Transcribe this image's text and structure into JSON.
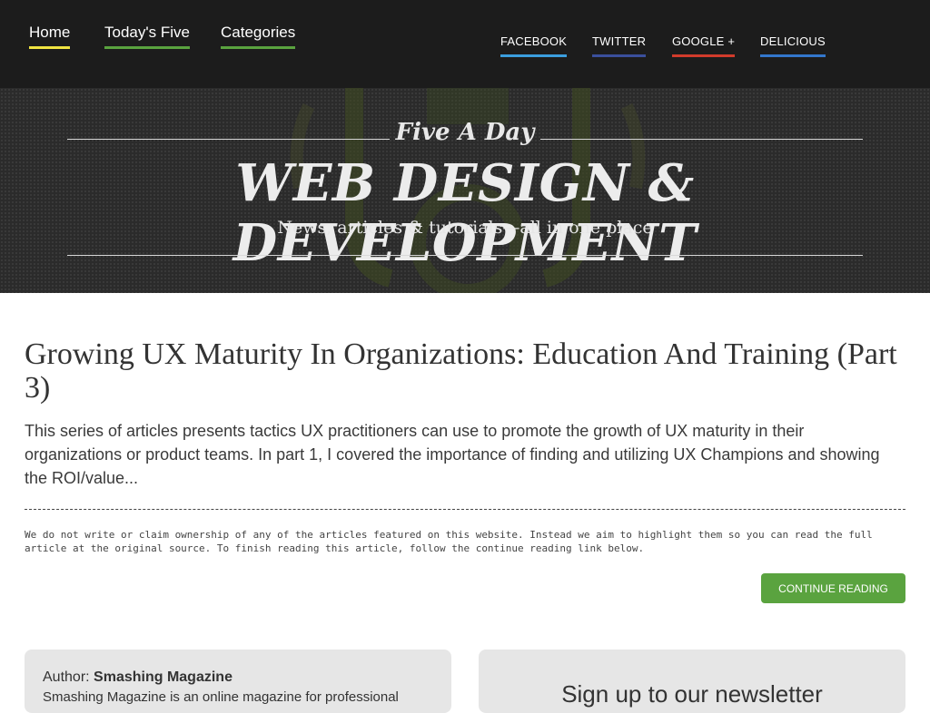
{
  "nav": {
    "main": [
      {
        "label": "Home",
        "color": "#f0e442"
      },
      {
        "label": "Today's Five",
        "color": "#5aa33f"
      },
      {
        "label": "Categories",
        "color": "#5aa33f"
      }
    ],
    "social": [
      {
        "label": "FACEBOOK",
        "color": "#3b9ede"
      },
      {
        "label": "TWITTER",
        "color": "#3a4f9c"
      },
      {
        "label": "GOOGLE +",
        "color": "#d13b2b"
      },
      {
        "label": "DELICIOUS",
        "color": "#3377cc"
      }
    ]
  },
  "hero": {
    "tagline": "Five A Day",
    "title": "WEB DESIGN & DEVELOPMENT",
    "subtitle": "News, articles & tutorials—all in one place"
  },
  "article": {
    "title": "Growing UX Maturity In Organizations: Education And Training (Part 3)",
    "excerpt": "This series of articles presents tactics UX practitioners can use to promote the growth of UX maturity in their organizations or product teams. In part 1, I covered the importance of finding and utilizing UX Champions and showing the ROI/value...",
    "disclaimer": "We do not write or claim ownership of any of the articles featured on this website. Instead we aim to highlight them so you can read the full article at the original source. To finish reading this article, follow the continue reading link below.",
    "continue_label": "CONTINUE READING"
  },
  "author": {
    "label": "Author:",
    "name": "Smashing Magazine",
    "bio": "Smashing Magazine is an online magazine for professional"
  },
  "newsletter": {
    "title": "Sign up to our newsletter"
  },
  "colors": {
    "accent_green": "#5aa33f",
    "topbar_bg": "#1c1c1c"
  }
}
